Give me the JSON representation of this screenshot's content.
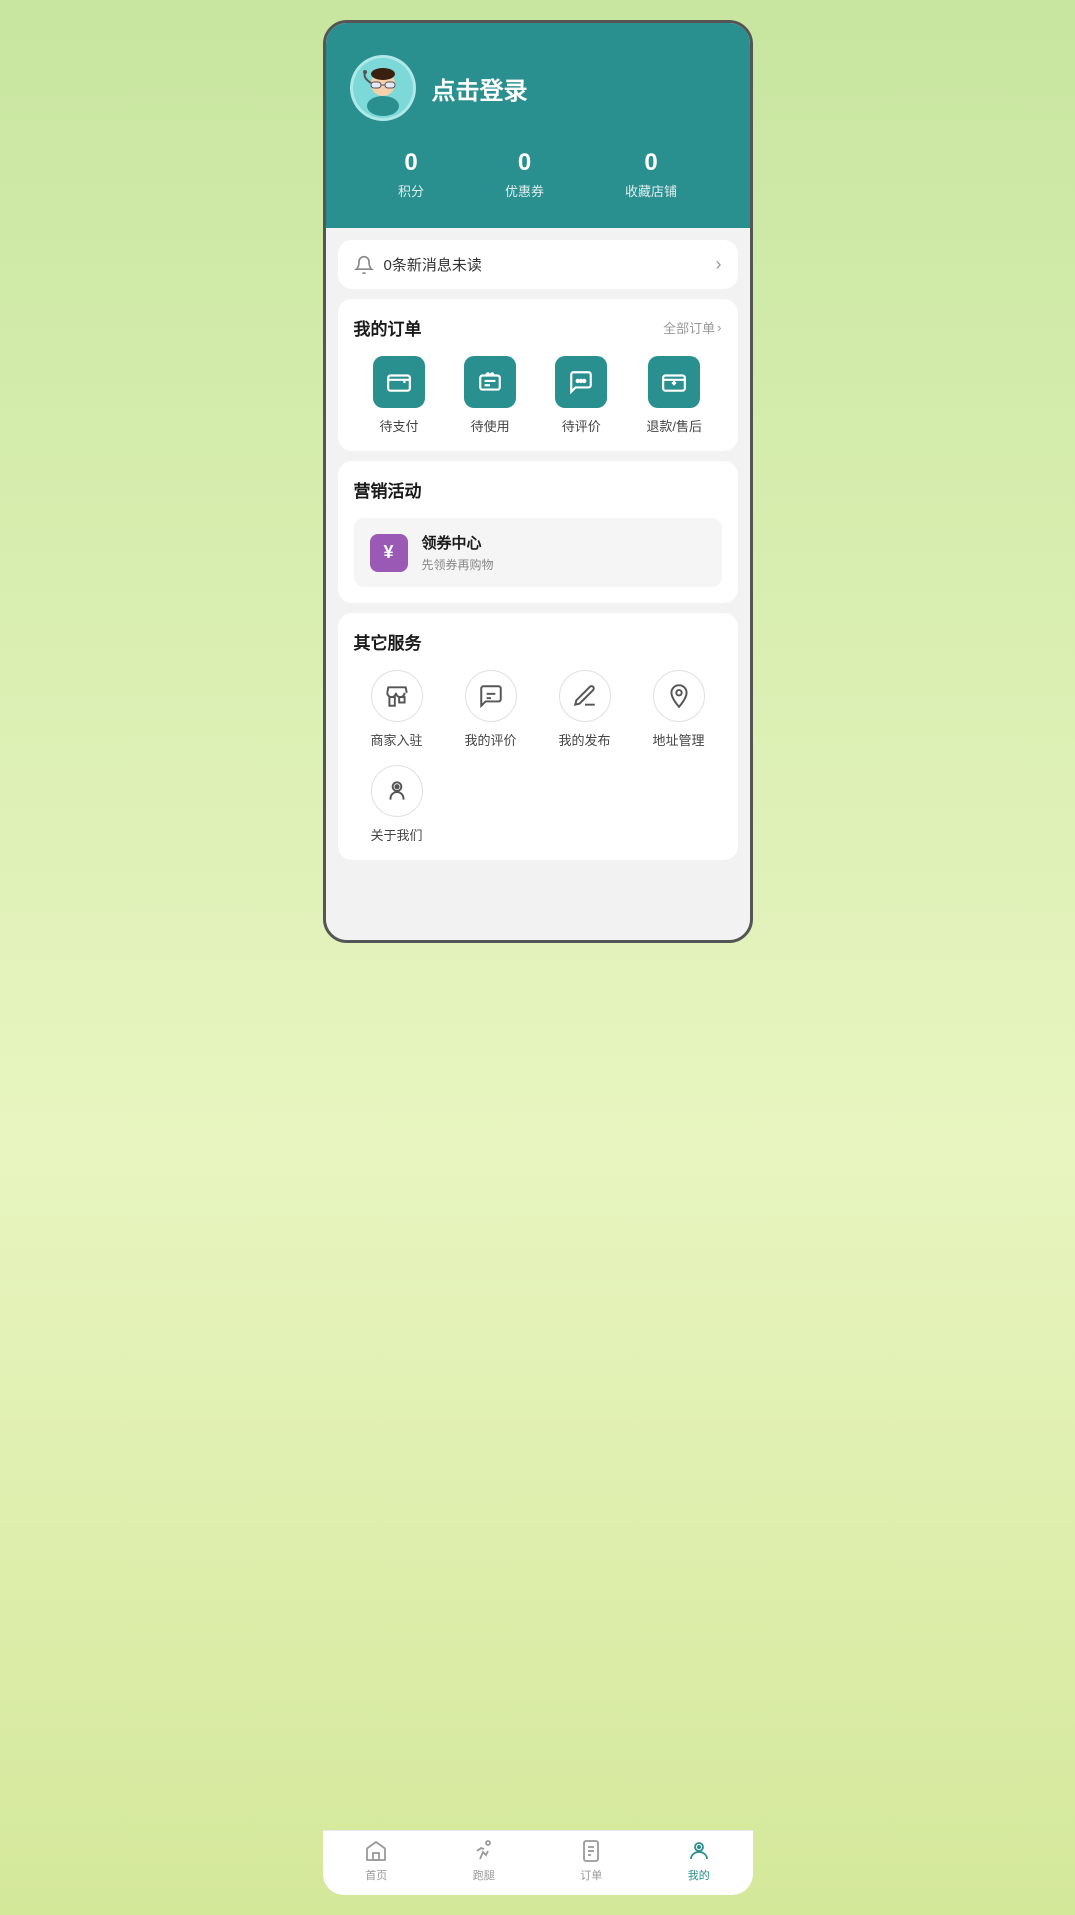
{
  "header": {
    "login_text": "点击登录",
    "stats": [
      {
        "number": "0",
        "label": "积分"
      },
      {
        "number": "0",
        "label": "优惠券"
      },
      {
        "number": "0",
        "label": "收藏店铺"
      }
    ]
  },
  "notification": {
    "text": "0条新消息未读"
  },
  "orders": {
    "title": "我的订单",
    "see_all": "全部订单",
    "items": [
      {
        "label": "待支付"
      },
      {
        "label": "待使用"
      },
      {
        "label": "待评价"
      },
      {
        "label": "退款/售后"
      }
    ]
  },
  "marketing": {
    "title": "营销活动",
    "coupon": {
      "title": "领券中心",
      "subtitle": "先领券再购物",
      "icon": "¥"
    }
  },
  "services": {
    "title": "其它服务",
    "items": [
      {
        "label": "商家入驻"
      },
      {
        "label": "我的评价"
      },
      {
        "label": "我的发布"
      },
      {
        "label": "地址管理"
      },
      {
        "label": "关于我们"
      }
    ]
  },
  "bottom_nav": {
    "items": [
      {
        "label": "首页",
        "active": false
      },
      {
        "label": "跑腿",
        "active": false
      },
      {
        "label": "订单",
        "active": false
      },
      {
        "label": "我的",
        "active": true
      }
    ]
  }
}
